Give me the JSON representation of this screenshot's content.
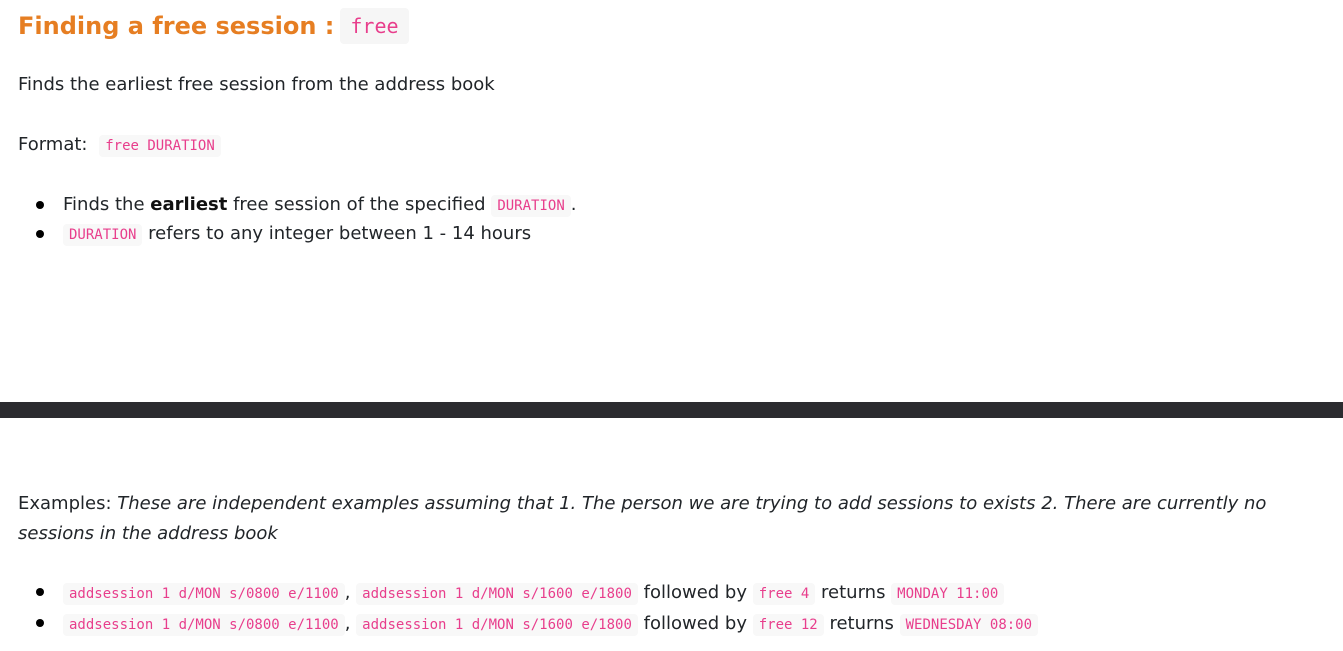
{
  "heading": {
    "title": "Finding a free session : ",
    "command": "free"
  },
  "description": "Finds the earliest free session from the address book",
  "format": {
    "label": "Format: ",
    "code": "free DURATION"
  },
  "bullets": {
    "b1_pre": "Finds the ",
    "b1_bold": "earliest",
    "b1_mid": " free session of the specified ",
    "b1_code": "DURATION",
    "b1_post": ".",
    "b2_code": "DURATION",
    "b2_text": " refers to any integer between 1 - 14 hours"
  },
  "examples": {
    "label": "Examples: ",
    "note": "These are independent examples assuming that 1. The person we are trying to add sessions to exists 2. There are currently no sessions in the address book",
    "items": [
      {
        "cmd1": "addsession 1 d/MON s/0800 e/1100",
        "sep": ", ",
        "cmd2": "addsession 1 d/MON s/1600 e/1800",
        "followed": " followed by ",
        "free_cmd": "free 4",
        "returns": " returns ",
        "result": "MONDAY 11:00"
      },
      {
        "cmd1": "addsession 1 d/MON s/0800 e/1100",
        "sep": ", ",
        "cmd2": "addsession 1 d/MON s/1600 e/1800",
        "followed": " followed by ",
        "free_cmd": "free 12",
        "returns": " returns ",
        "result": "WEDNESDAY 08:00"
      }
    ]
  }
}
